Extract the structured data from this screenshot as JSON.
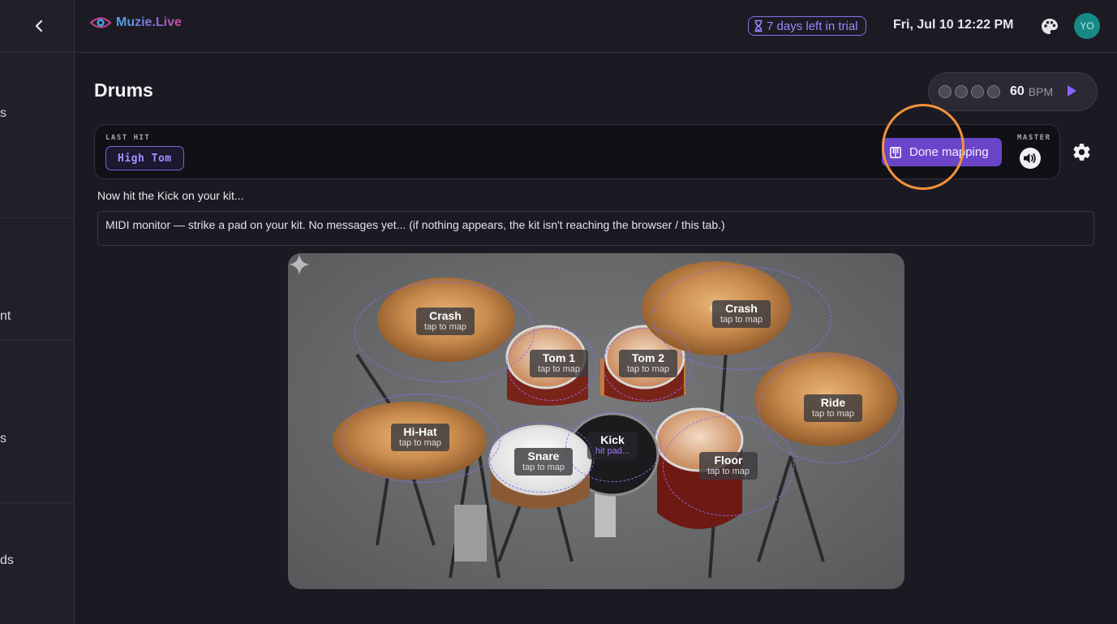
{
  "sidebar": {
    "items": [
      {
        "label": "s"
      },
      {
        "label": "nt"
      },
      {
        "label": "s"
      },
      {
        "label": "ds"
      }
    ]
  },
  "header": {
    "logo_text": "Muzie.Live",
    "trial_text": "7 days left in trial",
    "datetime": "Fri, Jul 10 12:22 PM",
    "avatar_initials": "YO"
  },
  "page": {
    "title": "Drums"
  },
  "metronome": {
    "beats": 4,
    "bpm": "60",
    "bpm_unit": "BPM"
  },
  "control_bar": {
    "last_hit_label": "LAST HIT",
    "last_hit_value": "High Tom",
    "done_button": "Done mapping",
    "master_label": "MASTER"
  },
  "instruction": "Now hit the Kick on your kit...",
  "midi_monitor": "MIDI monitor — strike a pad on your kit. No messages yet... (if nothing appears, the kit isn't reaching the browser / this tab.)",
  "pads": [
    {
      "name": "Crash",
      "hint": "tap to map"
    },
    {
      "name": "Crash",
      "hint": "tap to map"
    },
    {
      "name": "Tom 1",
      "hint": "tap to map"
    },
    {
      "name": "Tom 2",
      "hint": "tap to map"
    },
    {
      "name": "Ride",
      "hint": "tap to map"
    },
    {
      "name": "Hi-Hat",
      "hint": "tap to map"
    },
    {
      "name": "Snare",
      "hint": "tap to map"
    },
    {
      "name": "Kick",
      "hint": "hit pad..."
    },
    {
      "name": "Floor",
      "hint": "tap to map"
    }
  ],
  "colors": {
    "accent": "#6a45c9",
    "accent_text": "#9d84ff",
    "cursor_ring": "#f5923c",
    "avatar_bg": "#178a86"
  },
  "icons": [
    "chevron-left-icon",
    "eye-logo-icon",
    "hourglass-icon",
    "palette-icon",
    "play-icon",
    "piano-icon",
    "volume-icon",
    "gear-icon",
    "sparkle-icon"
  ]
}
